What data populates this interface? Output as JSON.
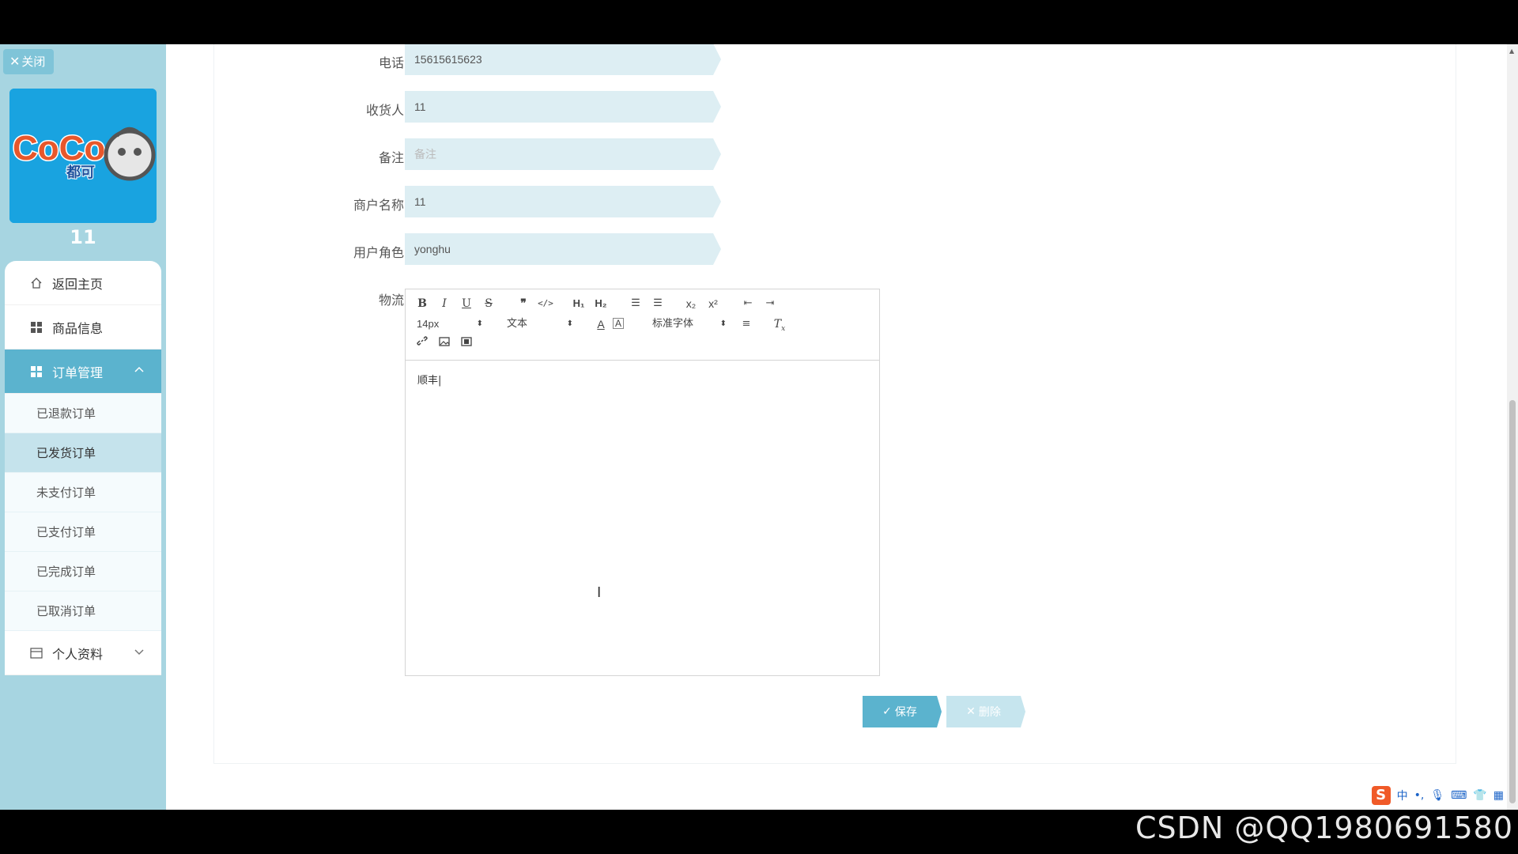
{
  "sidebar": {
    "close_label": "关闭",
    "logo_text": "CoCo",
    "logo_subtext": "都可",
    "username": "11",
    "menu": {
      "home": "返回主页",
      "goods": "商品信息",
      "orders": "订单管理",
      "orders_sub": [
        "已退款订单",
        "已发货订单",
        "未支付订单",
        "已支付订单",
        "已完成订单",
        "已取消订单"
      ],
      "profile": "个人资料"
    },
    "colors": {
      "bg": "#a7d5e1",
      "active": "#5bb3ce"
    }
  },
  "form": {
    "fields": [
      {
        "label": "电话",
        "value": "15615615623",
        "placeholder": ""
      },
      {
        "label": "收货人",
        "value": "11",
        "placeholder": ""
      },
      {
        "label": "备注",
        "value": "",
        "placeholder": "备注"
      },
      {
        "label": "商户名称",
        "value": "11",
        "placeholder": ""
      },
      {
        "label": "用户角色",
        "value": "yonghu",
        "placeholder": ""
      }
    ],
    "logistics_label": "物流",
    "editor": {
      "font_size": "14px",
      "heading_select": "文本",
      "font_family_select": "标准字体",
      "content": "顺丰"
    },
    "save_label": "保存",
    "delete_label": "删除"
  },
  "taskbar": {
    "ime_label": "中"
  },
  "watermark": "CSDN @QQ1980691580"
}
